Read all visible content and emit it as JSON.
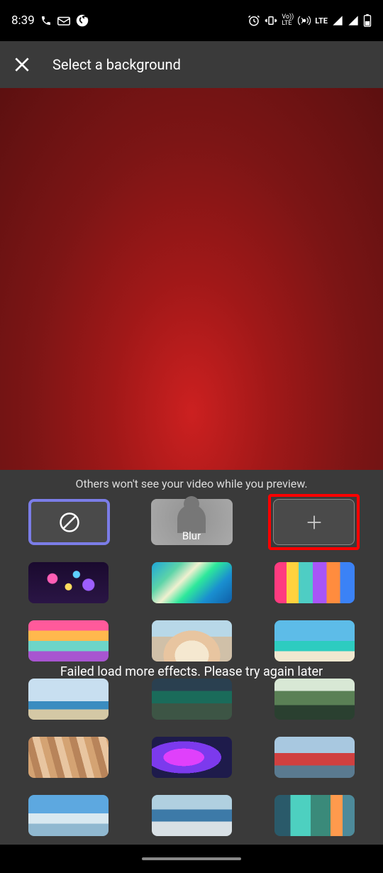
{
  "status": {
    "time": "8:39",
    "lte_label": "LTE"
  },
  "header": {
    "title": "Select a background"
  },
  "panel": {
    "hint": "Others won't see your video while you preview.",
    "blur_label": "Blur",
    "error": "Failed load more effects. Please try again later"
  },
  "thumbs": {
    "row1": [
      {
        "bg": "radial-gradient(circle at 30% 40%, #ff5eb5 0 8%, transparent 9%), radial-gradient(circle at 60% 30%, #5ecfff 0 6%, transparent 7%), radial-gradient(circle at 50% 60%, #ffdd5e 0 7%, transparent 8%), radial-gradient(circle at 75% 55%, #9d5eff 0 9%, transparent 10%), linear-gradient(#1a0a2e, #2a1545)"
      },
      {
        "bg": "linear-gradient(135deg, #1ea5d9 0%, #5dd4a8 25%, #f0f0d0 40%, #2de89b 55%, #1a8fd0 75%, #0f5fa8 100%)"
      },
      {
        "bg": "linear-gradient(90deg, #ff3b7f 0 15%, #ffd23e 15% 30%, #4ecdc4 30% 48%, #a855f7 48% 65%, #ff8c3e 65% 82%, #3b82f6 82% 100%)"
      }
    ],
    "row2": [
      {
        "bg": "linear-gradient(180deg, #ff5a9b 0 25%, #ffb84d 25% 50%, #6dd5c8 50% 75%, #a855d0 75% 100%)"
      },
      {
        "bg": "radial-gradient(ellipse at 50% 85%, #f5e8d0 0 30%, #e8c5a0 30% 50%, transparent 50%), linear-gradient(180deg, #b8d8e8 0 40%, #d0c0a8 40% 100%)"
      },
      {
        "bg": "linear-gradient(180deg, #5dbce8 0 50%, #2dccc0 50% 75%, #f0e8d0 75% 100%)"
      }
    ],
    "row3": [
      {
        "bg": "linear-gradient(180deg, #c8dff0 0 55%, #3a8cc0 55% 75%, #d4c8a5 75% 100%)"
      },
      {
        "bg": "linear-gradient(180deg, #2a4050 0 30%, #1a6b5a 30% 60%, #3d5545 60% 100%)"
      },
      {
        "bg": "linear-gradient(180deg, #d8e8d5 0 30%, #5a8055 30% 65%, #2a4030 65% 100%)"
      }
    ],
    "row4": [
      {
        "bg": "repeating-linear-gradient(75deg, #d4a373 0 10px, #b8845a 10px 20px, #e8c5a0 20px 30px)"
      },
      {
        "bg": "radial-gradient(ellipse at 40% 50%, #e040fb 0 30%, #7c3aed 30% 55%, #1e1b4b 55% 100%)"
      },
      {
        "bg": "linear-gradient(180deg, #a8c8e0 0 40%, #d04040 40% 70%, #5a7a90 70% 100%)"
      }
    ],
    "row5": [
      {
        "bg": "linear-gradient(180deg, #5da8e0 0 45%, #d8e8f0 45% 70%, #90b8d0 70% 100%)"
      },
      {
        "bg": "linear-gradient(180deg, #b0d0e0 0 35%, #3d7aa8 35% 65%, #d8e0e5 65% 100%)"
      },
      {
        "bg": "linear-gradient(90deg, #2a5a6a 0 20%, #4dd0c0 20% 45%, #3a8a7a 45% 70%, #ff9a4d 70% 85%, #4d8a9a 85% 100%)"
      }
    ]
  }
}
